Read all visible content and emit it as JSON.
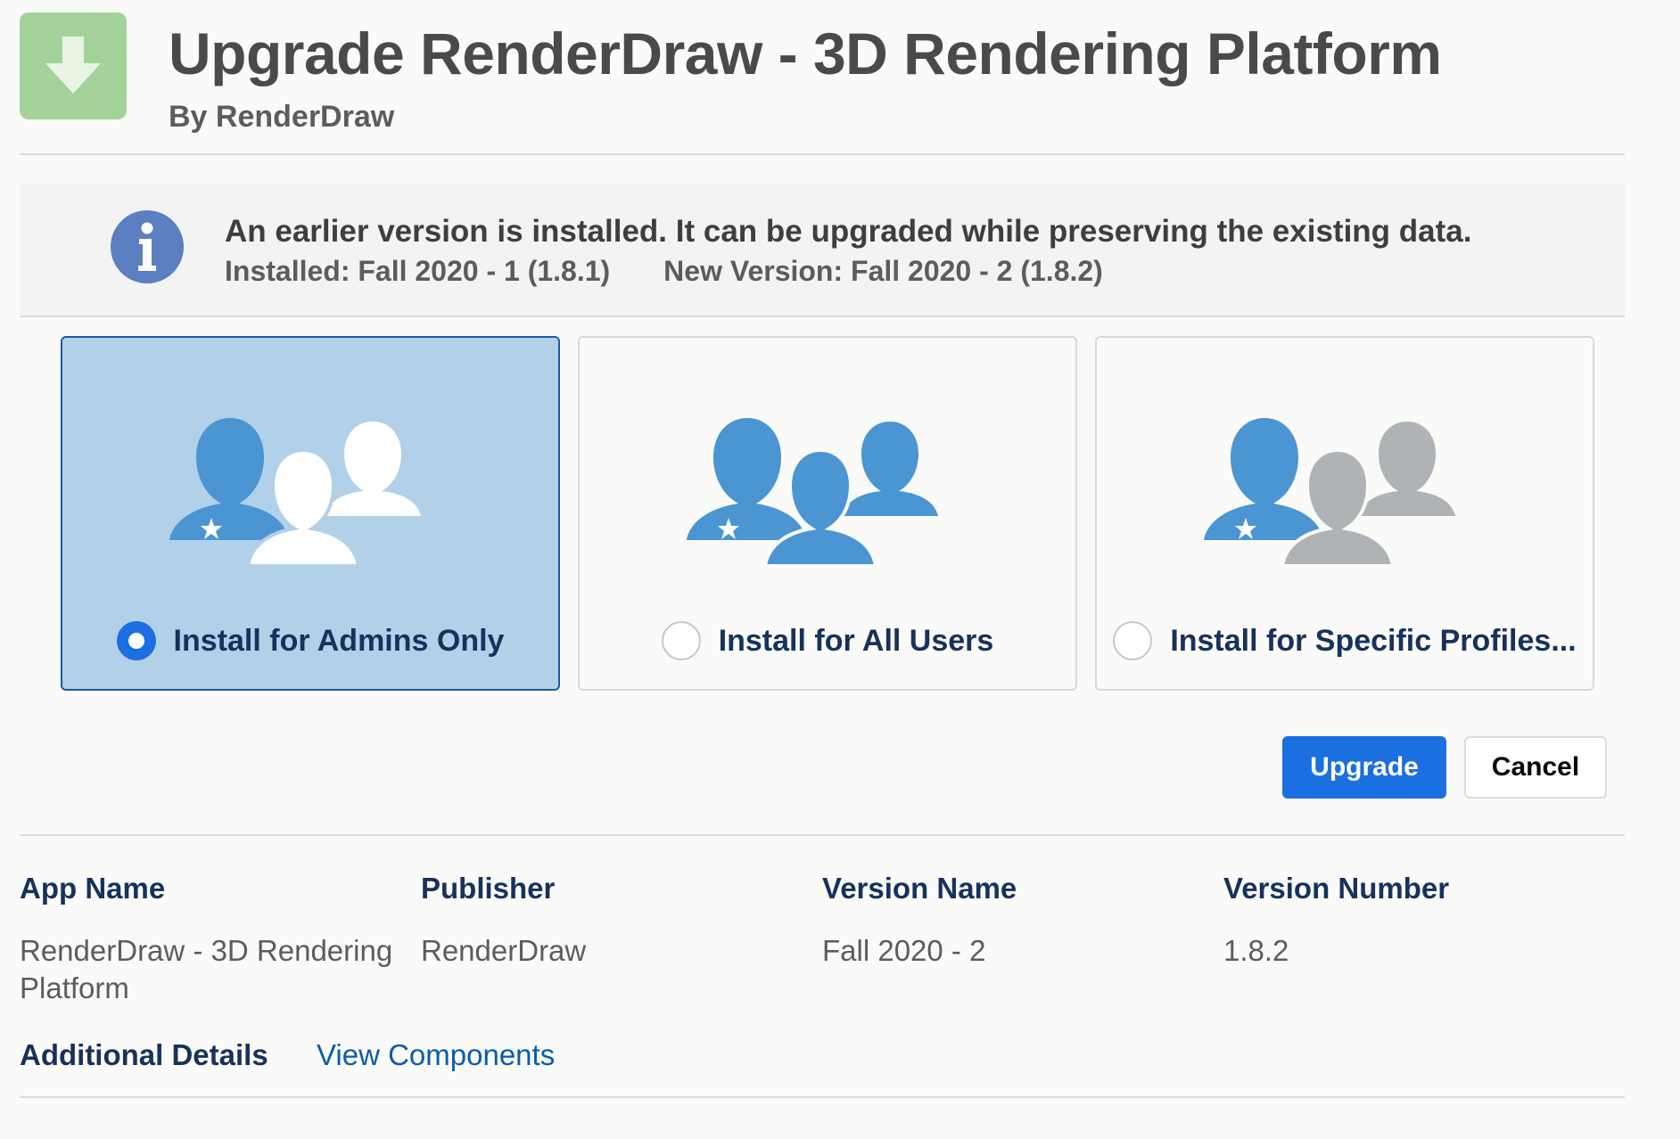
{
  "header": {
    "title": "Upgrade RenderDraw - 3D Rendering Platform",
    "subtitle": "By RenderDraw",
    "icon": "download-arrow-icon"
  },
  "banner": {
    "icon": "info-icon",
    "message": "An earlier version is installed. It can be upgraded while preserving the existing data.",
    "installed": "Installed: Fall 2020 - 1 (1.8.1)",
    "new_version": "New Version: Fall 2020 - 2 (1.8.2)"
  },
  "options": [
    {
      "label": "Install for Admins Only",
      "icon": "admins-only-people-icon",
      "selected": true
    },
    {
      "label": "Install for All Users",
      "icon": "all-users-people-icon",
      "selected": false
    },
    {
      "label": "Install for Specific Profiles...",
      "icon": "specific-profiles-people-icon",
      "selected": false
    }
  ],
  "actions": {
    "upgrade_label": "Upgrade",
    "cancel_label": "Cancel"
  },
  "details": {
    "columns": [
      {
        "heading": "App Name",
        "value": "RenderDraw - 3D Rendering Platform"
      },
      {
        "heading": "Publisher",
        "value": "RenderDraw"
      },
      {
        "heading": "Version Name",
        "value": "Fall 2020 - 2"
      },
      {
        "heading": "Version Number",
        "value": "1.8.2"
      }
    ],
    "additional_label": "Additional Details",
    "view_components_label": "View Components"
  },
  "colors": {
    "primary": "#1b6fe0",
    "selected_card": "#b2d0e8",
    "person_blue": "#4b95d3",
    "person_gray": "#b0b3b6",
    "heading_navy": "#16325c",
    "link": "#0b5cab"
  }
}
